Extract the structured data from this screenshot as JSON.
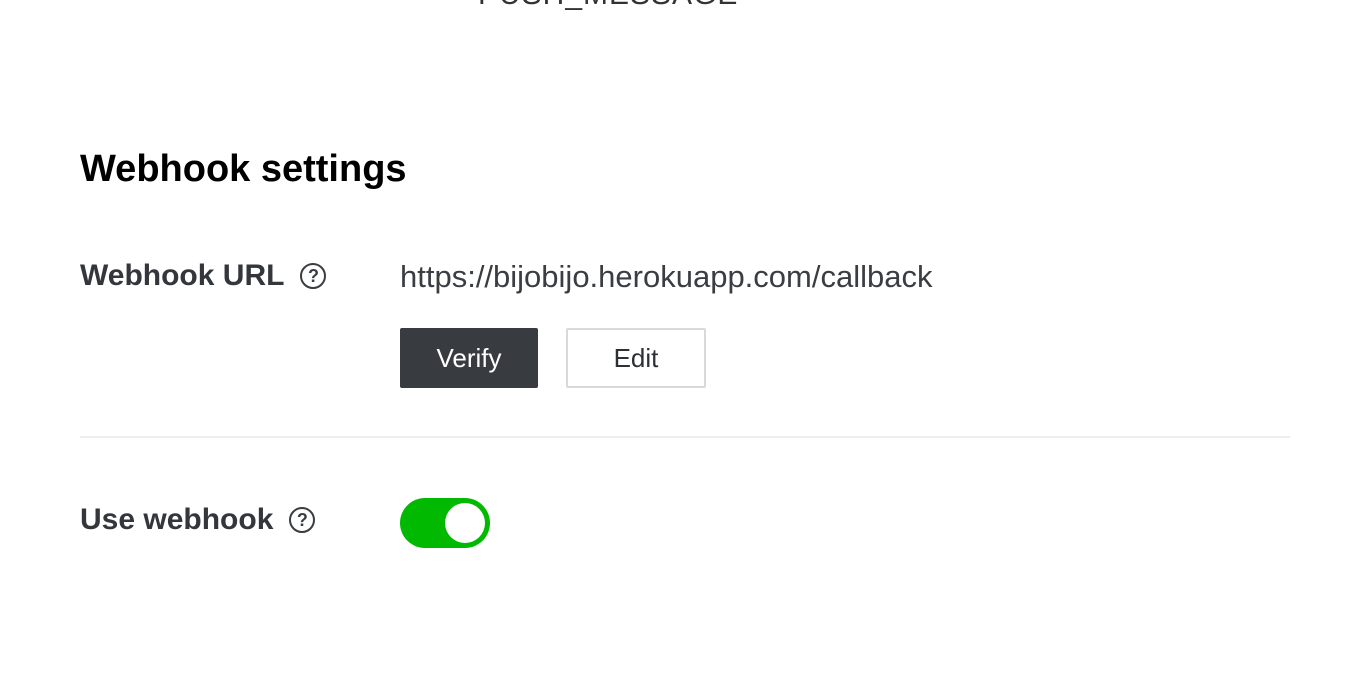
{
  "top_clipped_text": "PUSH_MESSAGE",
  "webhook": {
    "section_title": "Webhook settings",
    "url_label": "Webhook URL",
    "url_value": "https://bijobijo.herokuapp.com/callback",
    "verify_label": "Verify",
    "edit_label": "Edit",
    "use_label": "Use webhook",
    "use_enabled": true,
    "help_glyph": "?",
    "help_icon": "question-circle-icon"
  },
  "colors": {
    "toggle_on": "#00b900",
    "verify_bg": "#383b40"
  }
}
